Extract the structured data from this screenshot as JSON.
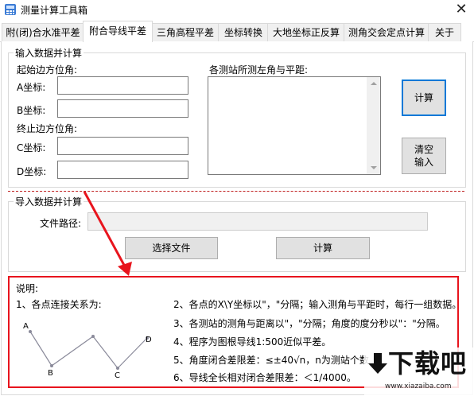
{
  "window": {
    "title": "测量计算工具箱",
    "close_symbol": "✕"
  },
  "tabs": [
    {
      "label": "附(闭)合水准平差",
      "active": false
    },
    {
      "label": "附合导线平差",
      "active": true
    },
    {
      "label": "三角高程平差",
      "active": false
    },
    {
      "label": "坐标转换",
      "active": false
    },
    {
      "label": "大地坐标正反算",
      "active": false
    },
    {
      "label": "测角交会定点计算",
      "active": false
    },
    {
      "label": "关于",
      "active": false
    }
  ],
  "input_group": {
    "title": "输入数据并计算",
    "start_label": "起始边方位角:",
    "a_label": "A坐标:",
    "a_value": "",
    "b_label": "B坐标:",
    "b_value": "",
    "end_label": "终止边方位角:",
    "c_label": "C坐标:",
    "c_value": "",
    "d_label": "D坐标:",
    "d_value": "",
    "stations_label": "各测站所测左角与平距:",
    "stations_value": "",
    "calc_button": "计算",
    "clear_button_line1": "清空",
    "clear_button_line2": "输入"
  },
  "import_group": {
    "title": "导入数据并计算",
    "path_label": "文件路径:",
    "path_value": "",
    "choose_button": "选择文件",
    "calc_button": "计算"
  },
  "notes": {
    "heading": "说明:",
    "item1": "1、各点连接关系为:",
    "item2": "2、各点的X\\Y坐标以\"，\"分隔；输入测角与平距时，每行一组数据。",
    "item3": "3、各测站的测角与距离以\"，\"分隔；角度的度分秒以\"：\"分隔。",
    "item4": "4、程序为图根导线1:500近似平差。",
    "item5": "5、角度闭合差限差：≤±40√n，n为测站个数",
    "item6": "6、导线全长相对闭合差限差：＜1/4000。",
    "diagram_points": [
      "A",
      "B",
      "C",
      "D"
    ]
  },
  "watermark": {
    "text": "下载吧",
    "url": "www.xiazaiba.com"
  },
  "colors": {
    "highlight_red": "#e8141d",
    "focus_blue": "#0078d7",
    "diagram_line": "#8a8a9a"
  }
}
